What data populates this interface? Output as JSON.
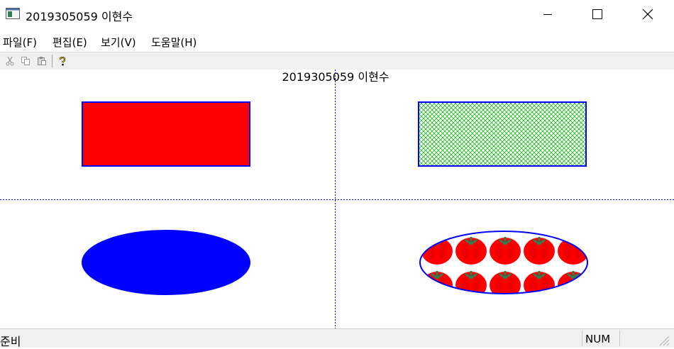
{
  "window": {
    "title": "2019305059 이현수",
    "icons": [
      "app-icon",
      "minimize-icon",
      "maximize-icon",
      "close-icon"
    ]
  },
  "menu": {
    "file": "파일(F)",
    "edit": "편집(E)",
    "view": "보기(V)",
    "help": "도움말(H)"
  },
  "toolbar": {
    "icons": [
      "cut-icon",
      "copy-icon",
      "paste-icon",
      "help-icon"
    ]
  },
  "client": {
    "title": "2019305059 이현수",
    "shapes": [
      {
        "kind": "rectangle",
        "fill": "solid-red",
        "border": "blue"
      },
      {
        "kind": "rectangle",
        "fill": "green-crosshatch",
        "border": "blue"
      },
      {
        "kind": "ellipse",
        "fill": "solid-blue",
        "border": "blue"
      },
      {
        "kind": "ellipse",
        "fill": "tomato-pattern",
        "border": "blue"
      }
    ]
  },
  "status": {
    "ready": "준비",
    "num": "NUM"
  },
  "colors": {
    "red": "#ff0000",
    "blue": "#0000ff",
    "hatch_green": "#22b822",
    "tomato_stem": "#2e7d4e"
  }
}
